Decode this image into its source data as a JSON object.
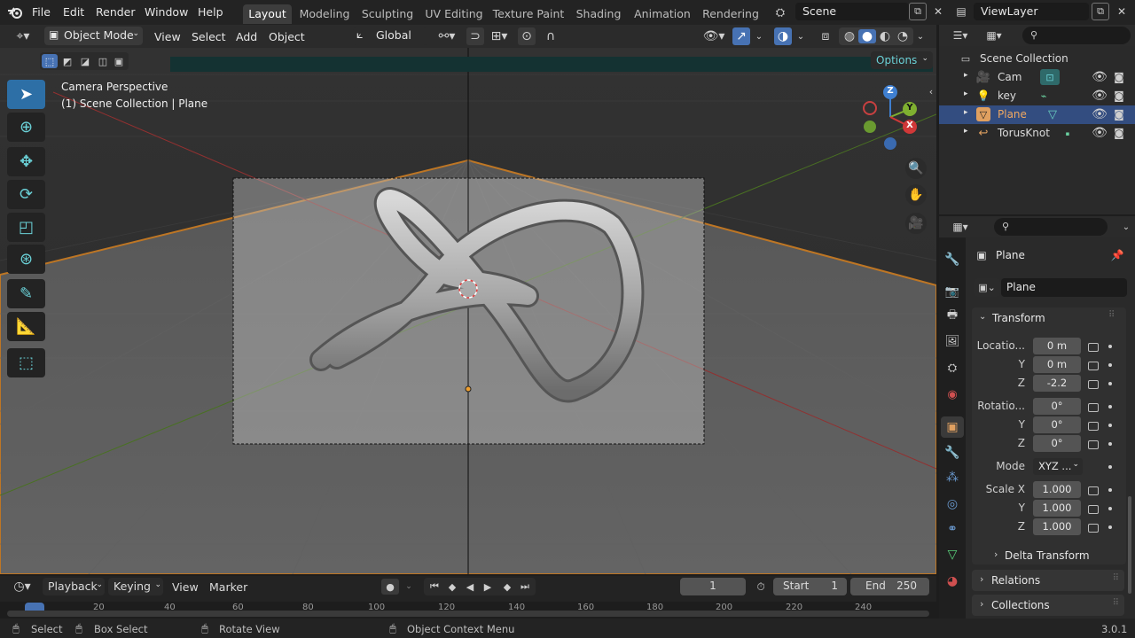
{
  "topbar": {
    "menus": [
      "File",
      "Edit",
      "Render",
      "Window",
      "Help"
    ],
    "workspace_tabs": [
      "Layout",
      "Modeling",
      "Sculpting",
      "UV Editing",
      "Texture Paint",
      "Shading",
      "Animation",
      "Rendering"
    ],
    "scene_name": "Scene",
    "view_layer": "ViewLayer"
  },
  "viewport_header": {
    "mode": "Object Mode",
    "menus": [
      "View",
      "Select",
      "Add",
      "Object"
    ],
    "transform_orientation": "Global",
    "options_label": "Options"
  },
  "viewport": {
    "title": "Camera Perspective",
    "subtitle": "(1) Scene Collection | Plane",
    "gizmo_axes": [
      "Z",
      "Y",
      "X"
    ]
  },
  "outliner": {
    "root": "Scene Collection",
    "items": [
      {
        "name": "Cam",
        "selected": false
      },
      {
        "name": "key",
        "selected": false
      },
      {
        "name": "Plane",
        "selected": true
      },
      {
        "name": "TorusKnot",
        "selected": false
      }
    ]
  },
  "properties": {
    "object_name": "Plane",
    "datablock_name": "Plane",
    "transform_label": "Transform",
    "location_label": "Locatio...",
    "location": {
      "x": "0 m",
      "y": "0 m",
      "z": "-2.2"
    },
    "rotation_label": "Rotatio...",
    "rotation": {
      "x": "0°",
      "y": "0°",
      "z": "0°"
    },
    "mode_label": "Mode",
    "mode_value": "XYZ ...",
    "scale_label": "Scale X",
    "scale": {
      "x": "1.000",
      "y": "1.000",
      "z": "1.000"
    },
    "axis_y": "Y",
    "axis_z": "Z",
    "delta_transform": "Delta Transform",
    "relations": "Relations",
    "collections": "Collections"
  },
  "timeline": {
    "menus": [
      "Playback",
      "Keying",
      "View",
      "Marker"
    ],
    "current_frame": "1",
    "start_label": "Start",
    "start_value": "1",
    "end_label": "End",
    "end_value": "250",
    "ruler": [
      "20",
      "40",
      "60",
      "80",
      "100",
      "120",
      "140",
      "160",
      "180",
      "200",
      "220",
      "240"
    ]
  },
  "statusbar": {
    "select": "Select",
    "box_select": "Box Select",
    "rotate_view": "Rotate View",
    "context_menu": "Object Context Menu",
    "version": "3.0.1"
  },
  "colors": {
    "accent": "#4772b3",
    "selection": "#334d80",
    "active_tool": "#2d6fa6",
    "plane_outline": "#e8902c"
  }
}
